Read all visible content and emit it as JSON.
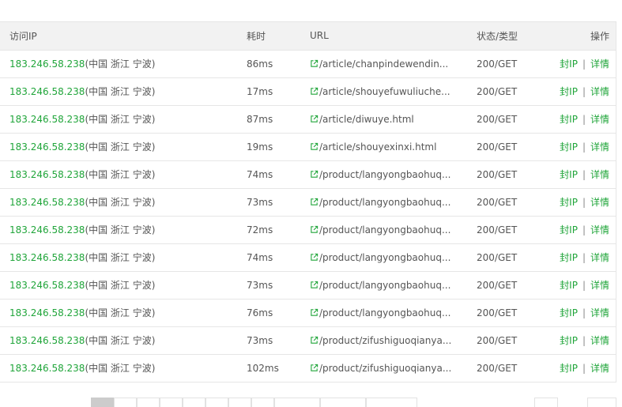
{
  "columns": {
    "ip": "访问IP",
    "time": "耗时",
    "url": "URL",
    "status": "状态/类型",
    "ops": "操作"
  },
  "actions": {
    "block": "封IP",
    "sep": "|",
    "detail": "详情"
  },
  "rows": [
    {
      "ip": "183.246.58.238",
      "loc": "(中国 浙江 宁波)",
      "time": "86ms",
      "url": "/article/chanpindewendin...",
      "status": "200/GET"
    },
    {
      "ip": "183.246.58.238",
      "loc": "(中国 浙江 宁波)",
      "time": "17ms",
      "url": "/article/shouyefuwuliuche...",
      "status": "200/GET"
    },
    {
      "ip": "183.246.58.238",
      "loc": "(中国 浙江 宁波)",
      "time": "87ms",
      "url": "/article/diwuye.html",
      "status": "200/GET"
    },
    {
      "ip": "183.246.58.238",
      "loc": "(中国 浙江 宁波)",
      "time": "19ms",
      "url": "/article/shouyexinxi.html",
      "status": "200/GET"
    },
    {
      "ip": "183.246.58.238",
      "loc": "(中国 浙江 宁波)",
      "time": "74ms",
      "url": "/product/langyongbaohuq...",
      "status": "200/GET"
    },
    {
      "ip": "183.246.58.238",
      "loc": "(中国 浙江 宁波)",
      "time": "73ms",
      "url": "/product/langyongbaohuq...",
      "status": "200/GET"
    },
    {
      "ip": "183.246.58.238",
      "loc": "(中国 浙江 宁波)",
      "time": "72ms",
      "url": "/product/langyongbaohuq...",
      "status": "200/GET"
    },
    {
      "ip": "183.246.58.238",
      "loc": "(中国 浙江 宁波)",
      "time": "74ms",
      "url": "/product/langyongbaohuq...",
      "status": "200/GET"
    },
    {
      "ip": "183.246.58.238",
      "loc": "(中国 浙江 宁波)",
      "time": "73ms",
      "url": "/product/langyongbaohuq...",
      "status": "200/GET"
    },
    {
      "ip": "183.246.58.238",
      "loc": "(中国 浙江 宁波)",
      "time": "76ms",
      "url": "/product/langyongbaohuq...",
      "status": "200/GET"
    },
    {
      "ip": "183.246.58.238",
      "loc": "(中国 浙江 宁波)",
      "time": "73ms",
      "url": "/product/zifushiguoqianya...",
      "status": "200/GET"
    },
    {
      "ip": "183.246.58.238",
      "loc": "(中国 浙江 宁波)",
      "time": "102ms",
      "url": "/product/zifushiguoqianya...",
      "status": "200/GET"
    }
  ],
  "colors": {
    "accent": "#20a53a",
    "border": "#e6e6e6",
    "header_bg": "#f2f2f2"
  },
  "icons": {
    "url": "external-link-icon"
  }
}
